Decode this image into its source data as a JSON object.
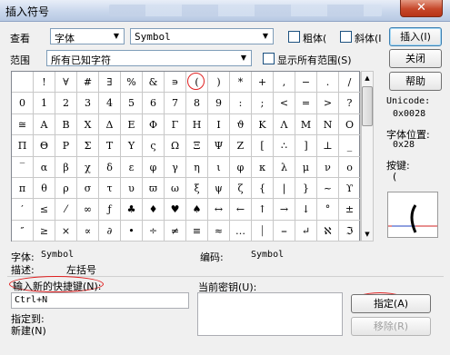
{
  "window": {
    "title": "插入符号",
    "close_label": "✕"
  },
  "toolbar": {
    "view_label": "查看",
    "view_value": "字体",
    "font_value": "Symbol",
    "bold_label": "粗体(",
    "italic_label": "斜体(I",
    "insert_label": "插入(I)"
  },
  "range": {
    "label": "范围",
    "value": "所有已知字符",
    "show_all_label": "显示所有范围(S)"
  },
  "side": {
    "close_label": "关闭",
    "help_label": "帮助",
    "unicode_label": "Unicode:",
    "unicode_value": "0x0028",
    "font_pos_label": "字体位置:",
    "font_pos_value": "0x28",
    "key_label": "按键:",
    "key_value": "("
  },
  "grid": {
    "rows": [
      [
        "",
        "!",
        "∀",
        "#",
        "∃",
        "%",
        "&",
        "∍",
        "(",
        ")",
        "*",
        "+",
        ",",
        "−",
        ".",
        "/"
      ],
      [
        "0",
        "1",
        "2",
        "3",
        "4",
        "5",
        "6",
        "7",
        "8",
        "9",
        ":",
        ";",
        "<",
        "=",
        ">",
        "?"
      ],
      [
        "≅",
        "Α",
        "Β",
        "Χ",
        "Δ",
        "Ε",
        "Φ",
        "Γ",
        "Η",
        "Ι",
        "ϑ",
        "Κ",
        "Λ",
        "Μ",
        "Ν",
        "Ο"
      ],
      [
        "Π",
        "Θ",
        "Ρ",
        "Σ",
        "Τ",
        "Υ",
        "ς",
        "Ω",
        "Ξ",
        "Ψ",
        "Ζ",
        "[",
        "∴",
        "]",
        "⊥",
        "_"
      ],
      [
        "‾",
        "α",
        "β",
        "χ",
        "δ",
        "ε",
        "φ",
        "γ",
        "η",
        "ι",
        "φ",
        "κ",
        "λ",
        "μ",
        "ν",
        "ο"
      ],
      [
        "π",
        "θ",
        "ρ",
        "σ",
        "τ",
        "υ",
        "ϖ",
        "ω",
        "ξ",
        "ψ",
        "ζ",
        "{",
        "|",
        "}",
        "~",
        "ϒ"
      ],
      [
        "′",
        "≤",
        "⁄",
        "∞",
        "ƒ",
        "♣",
        "♦",
        "♥",
        "♠",
        "↔",
        "←",
        "↑",
        "→",
        "↓",
        "°",
        "±"
      ],
      [
        "″",
        "≥",
        "×",
        "∝",
        "∂",
        "•",
        "÷",
        "≠",
        "≡",
        "≈",
        "…",
        "⏐",
        "⎯",
        "↵",
        "ℵ",
        "ℑ"
      ]
    ]
  },
  "info": {
    "font_label": "字体:",
    "font_value": "Symbol",
    "code_label": "编码:",
    "code_value": "Symbol",
    "desc_label": "描述:",
    "desc_value": "左括号"
  },
  "shortcut": {
    "new_key_label": "输入新的快捷键(N):",
    "new_key_value": "Ctrl+N",
    "current_keys_label": "当前密钥(U):",
    "assigned_label": "指定到:",
    "assigned_value": "新建(N)",
    "assign_button": "指定(A)",
    "remove_button": "移除(R)"
  }
}
